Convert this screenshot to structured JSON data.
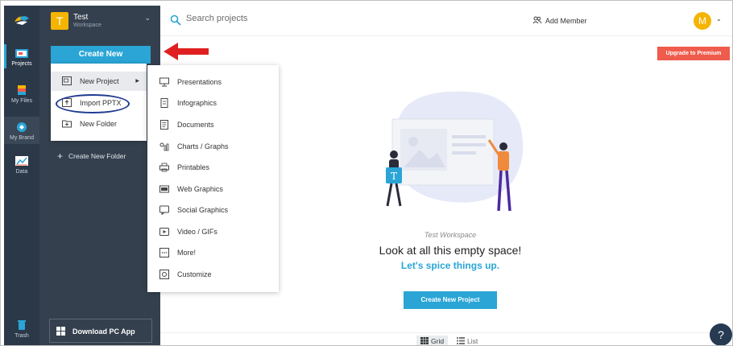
{
  "rail": {
    "items": [
      {
        "label": "Projects"
      },
      {
        "label": "My Files"
      },
      {
        "label": "My Brand"
      },
      {
        "label": "Data"
      },
      {
        "label": "Trash"
      }
    ]
  },
  "workspace": {
    "avatar_letter": "T",
    "name": "Test",
    "subtitle": "Workspace"
  },
  "sidebar": {
    "create_new_label": "Create New",
    "create_new_folder_label": "Create New Folder",
    "download_app_label": "Download PC App"
  },
  "create_menu": {
    "items": [
      {
        "label": "New Project"
      },
      {
        "label": "Import PPTX"
      },
      {
        "label": "New Folder"
      }
    ]
  },
  "project_types": {
    "items": [
      {
        "label": "Presentations"
      },
      {
        "label": "Infographics"
      },
      {
        "label": "Documents"
      },
      {
        "label": "Charts / Graphs"
      },
      {
        "label": "Printables"
      },
      {
        "label": "Web Graphics"
      },
      {
        "label": "Social Graphics"
      },
      {
        "label": "Video / GIFs"
      },
      {
        "label": "More!"
      },
      {
        "label": "Customize"
      }
    ]
  },
  "topbar": {
    "search_placeholder": "Search projects",
    "add_member_label": "Add Member",
    "user_avatar_letter": "M"
  },
  "upgrade_label": "Upgrade to Premium",
  "empty_state": {
    "workspace_name": "Test Workspace",
    "title": "Look at all this empty space!",
    "subtitle": "Let's spice things up.",
    "illustration_letter": "T",
    "button_label": "Create New Project"
  },
  "view_toggle": {
    "grid_label": "Grid",
    "list_label": "List"
  },
  "help_label": "?",
  "colors": {
    "accent": "#2aa5d6",
    "rail_bg": "#2b3848",
    "panel_bg": "#34404e",
    "premium": "#ef5b4c",
    "workspace_avatar": "#f5b400",
    "annotation_arrow": "#e02020",
    "annotation_ellipse": "#1f3a8f"
  }
}
